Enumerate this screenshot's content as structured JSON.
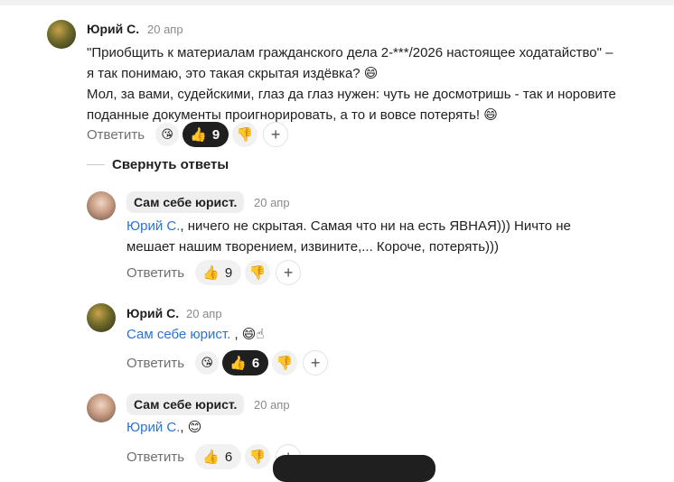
{
  "comments": [
    {
      "author": "Юрий С.",
      "date": "20 апр",
      "text_lines": [
        "\"Приобщить к материалам гражданского дела 2-***/2026 настоящее ходатайство\" –",
        "я так понимаю, это такая скрытая издёвка? 😄",
        "Мол, за вами, судейскими, глаз да глаз нужен: чуть не досмотришь - так и норовите",
        "поданные документы проигнорировать, а то и вовсе потерять! 😄"
      ],
      "reply_label": "Ответить",
      "like_count": "9"
    },
    {
      "author": "Сам себе юрист.",
      "date": "20 апр",
      "mention": "Юрий С.",
      "text_line1_rest": ", ничего не скрытая. Самая что ни на есть ЯВНАЯ))) Ничто не",
      "text_line2": "мешает нашим творением, извините,... Короче, потерять)))",
      "reply_label": "Ответить",
      "like_count": "9"
    },
    {
      "author": "Юрий С.",
      "date": "20 апр",
      "mention": "Сам себе юрист.",
      "text_rest": " , 😄☝",
      "reply_label": "Ответить",
      "like_count": "6"
    },
    {
      "author": "Сам себе юрист.",
      "date": "20 апр",
      "mention": "Юрий С.",
      "text_rest": ", 😊",
      "reply_label": "Ответить",
      "like_count": "6"
    }
  ],
  "collapse_label": "Свернуть ответы",
  "icons": {
    "like": "👍",
    "dislike": "👎",
    "plus": "+",
    "heart_reaction": "😘"
  }
}
